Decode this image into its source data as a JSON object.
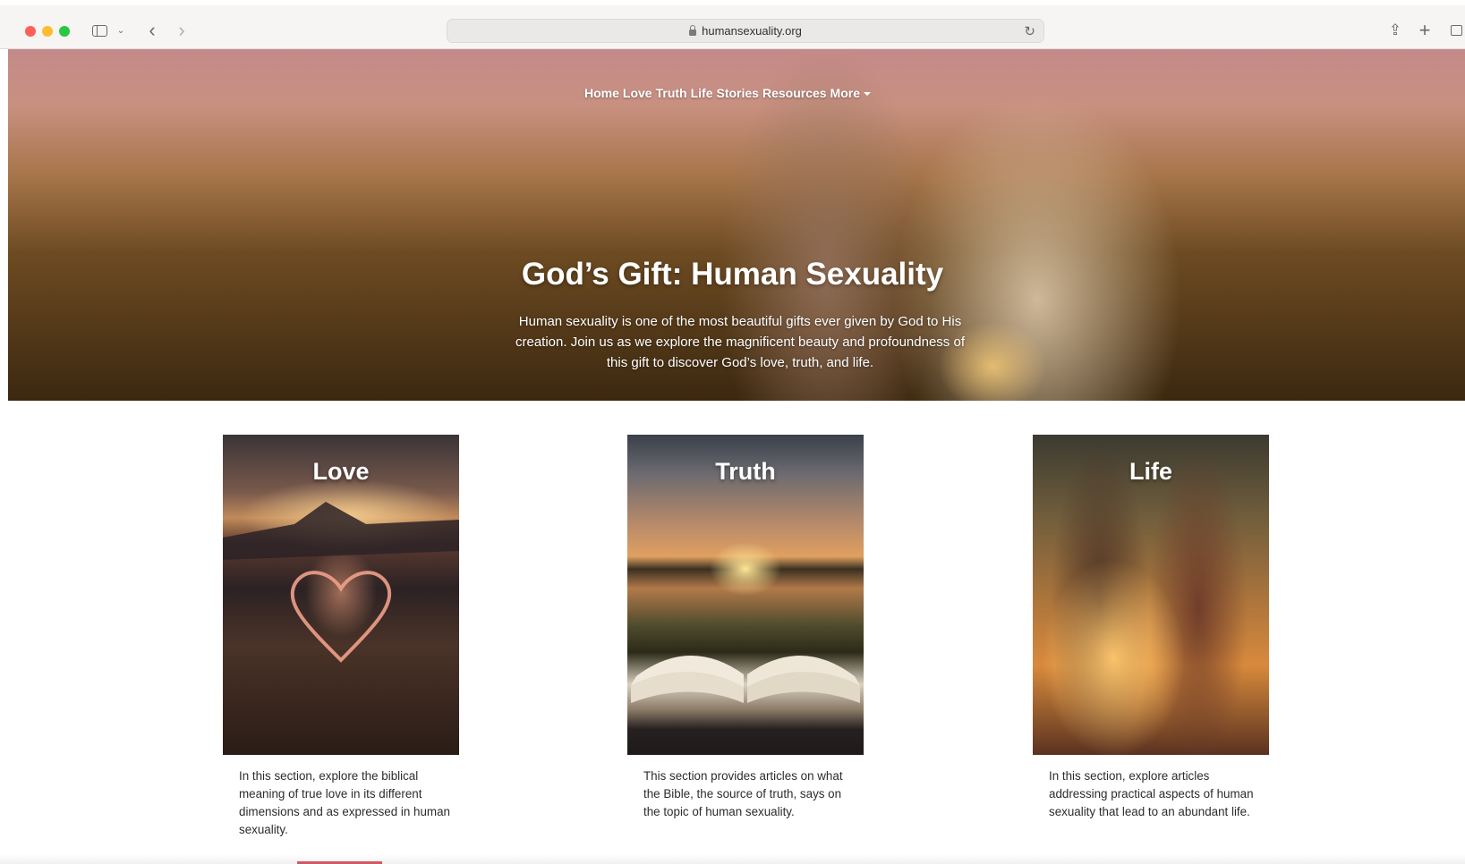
{
  "browser": {
    "url": "humansexuality.org"
  },
  "nav": {
    "items": [
      "Home",
      "Love",
      "Truth",
      "Life",
      "Stories",
      "Resources"
    ],
    "more_label": "More"
  },
  "hero": {
    "title": "God’s Gift: Human Sexuality",
    "description": "Human sexuality is one of the most beautiful gifts ever given by God to His creation. Join us as we explore the magnificent beauty and profoundness of this gift to discover God’s love, truth, and life."
  },
  "cards": [
    {
      "title": "Love",
      "text": "In this section, explore the biblical meaning of true love in its different dimensions and as expressed in human sexuality."
    },
    {
      "title": "Truth",
      "text": "This section provides articles on what the Bible, the source of truth, says on the topic of human sexuality."
    },
    {
      "title": "Life",
      "text": "In this section, explore articles addressing practical aspects of human sexuality that lead to an abundant life."
    }
  ],
  "icons": {
    "sidebar": "sidebar-icon",
    "back": "chevron-left-icon",
    "forward": "chevron-right-icon",
    "lock": "lock-icon",
    "reload": "reload-icon",
    "share": "share-icon",
    "new_tab": "plus-icon",
    "tabs": "tabs-icon"
  },
  "colors": {
    "close": "#ff5f57",
    "minimize": "#febc2e",
    "zoom": "#28c840"
  }
}
